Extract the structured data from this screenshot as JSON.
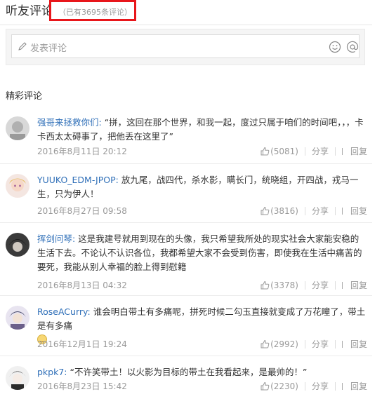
{
  "header": {
    "title": "听友评论",
    "count_text": "（已有3695条评论）"
  },
  "composer": {
    "placeholder": "发表评论"
  },
  "featured_label": "精彩评论",
  "comments": [
    {
      "user": "强哥来拯救你们:",
      "text": " “拼，这回在那个世界，和我一起，度过只属于咱们的时间吧，，，卡卡西太太碍事了，把他丢在这里了”",
      "time": "2016年8月11日 20:12",
      "likes": "(5081)"
    },
    {
      "user": "YUUKO_EDM-JPOP:",
      "text": " 放九尾，战四代，杀水影，瞒长门，统晓组，开四战，戎马一生，只为伊人！",
      "time": "2016年8月27日 09:58",
      "likes": "(3816)"
    },
    {
      "user": "挥剑问琴:",
      "text": " 这是我建号就用到现在的头像，我只希望我所处的现实社会大家能安稳的生活下去。不论认不认识各位，我都希望大家不会受到伤害，即使我在生活中痛苦的要死，我能从别人幸福的脸上得到慰籍",
      "time": "2016年8月13日 04:32",
      "likes": "(3378)"
    },
    {
      "user": "RoseACurry:",
      "text": " 谁会明白带土有多痛呢，拼死时候二勾玉直接就变成了万花瞳了，带土是有多痛",
      "time": "2016年12月1日 19:24",
      "likes": "(2992)"
    },
    {
      "user": "pkpk7:",
      "text": " “不许笑带土！以火影为目标的带土在我看起来，是最帅的！”",
      "time": "2016年8月23日 15:42",
      "likes": "(2230)"
    }
  ],
  "actions": {
    "share": "分享",
    "reply": "回复"
  },
  "colors": {
    "username": "#2f6fb8",
    "highlight_border": "#e8161b"
  },
  "icons": {
    "composer": [
      "pencil-icon",
      "smile-icon",
      "at-icon"
    ],
    "actions": [
      "thumbs-up-icon",
      "reply-icon"
    ]
  }
}
